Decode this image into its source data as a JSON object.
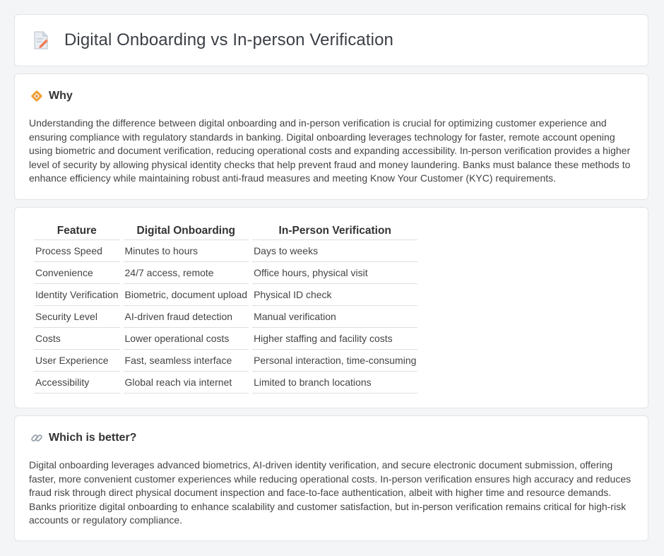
{
  "header": {
    "title": "Digital Onboarding vs In-person Verification",
    "icon": "document-pencil-icon"
  },
  "why": {
    "heading": "Why",
    "icon": "diamond-sign-icon",
    "text": "Understanding the difference between digital onboarding and in-person verification is crucial for optimizing customer experience and ensuring compliance with regulatory standards in banking. Digital onboarding leverages technology for faster, remote account opening using biometric and document verification, reducing operational costs and expanding accessibility. In-person verification provides a higher level of security by allowing physical identity checks that help prevent fraud and money laundering. Banks must balance these methods to enhance efficiency while maintaining robust anti-fraud measures and meeting Know Your Customer (KYC) requirements."
  },
  "table": {
    "headers": [
      "Feature",
      "Digital Onboarding",
      "In-Person Verification"
    ],
    "rows": [
      [
        "Process Speed",
        "Minutes to hours",
        "Days to weeks"
      ],
      [
        "Convenience",
        "24/7 access, remote",
        "Office hours, physical visit"
      ],
      [
        "Identity Verification",
        "Biometric, document upload",
        "Physical ID check"
      ],
      [
        "Security Level",
        "AI-driven fraud detection",
        "Manual verification"
      ],
      [
        "Costs",
        "Lower operational costs",
        "Higher staffing and facility costs"
      ],
      [
        "User Experience",
        "Fast, seamless interface",
        "Personal interaction, time-consuming"
      ],
      [
        "Accessibility",
        "Global reach via internet",
        "Limited to branch locations"
      ]
    ]
  },
  "better": {
    "heading": "Which is better?",
    "icon": "link-icon",
    "text": "Digital onboarding leverages advanced biometrics, AI-driven identity verification, and secure electronic document submission, offering faster, more convenient customer experiences while reducing operational costs. In-person verification ensures high accuracy and reduces fraud risk through direct physical document inspection and face-to-face authentication, albeit with higher time and resource demands. Banks prioritize digital onboarding to enhance scalability and customer satisfaction, but in-person verification remains critical for high-risk accounts or regulatory compliance."
  },
  "colors": {
    "background": "#f4f5f7",
    "card": "#ffffff",
    "border": "#e2e4e8",
    "accent": "#f0a23a"
  }
}
